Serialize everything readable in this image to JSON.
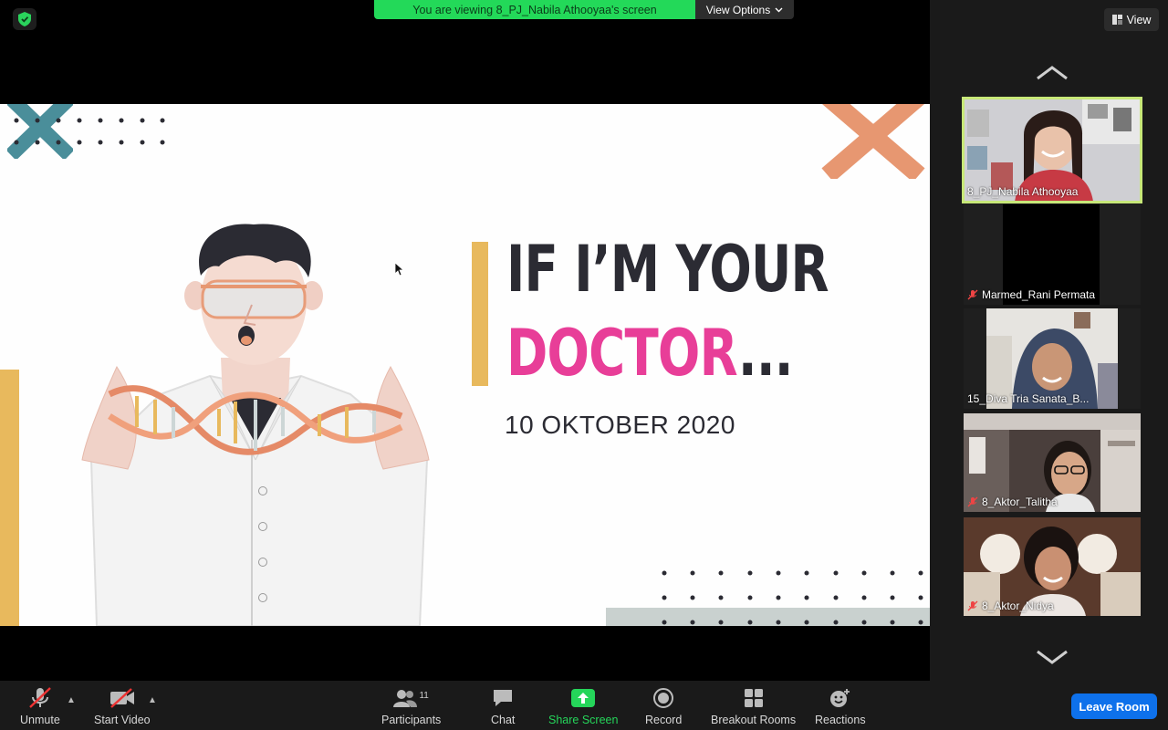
{
  "meeting": {
    "banner_text": "You are viewing 8_PJ_Nabila Athooyaa's screen",
    "view_options_label": "View Options",
    "view_label": "View"
  },
  "slide": {
    "title_line1": "IF I’M YOUR",
    "title_line2_highlight": "DOCTOR",
    "title_line2_rest": "...",
    "date": "10 OKTOBER 2020",
    "colors": {
      "pink": "#e83e98",
      "dark": "#2b2b33",
      "yellow": "#e8b95d",
      "orange": "#e79771",
      "teal": "#4a8e9a"
    }
  },
  "participants": [
    {
      "name": "8_PJ_Nabila Athooyaa",
      "muted": false,
      "active_speaker": true,
      "video": true
    },
    {
      "name": "Marmed_Rani Permata",
      "muted": true,
      "active_speaker": false,
      "video": false
    },
    {
      "name": "15_Diva Tria Sanata_B...",
      "muted": false,
      "active_speaker": false,
      "video": true
    },
    {
      "name": "8_Aktor_Talitha",
      "muted": true,
      "active_speaker": false,
      "video": true
    },
    {
      "name": "8_Aktor_Nidya",
      "muted": true,
      "active_speaker": false,
      "video": true
    }
  ],
  "toolbar": {
    "unmute_label": "Unmute",
    "start_video_label": "Start Video",
    "participants_label": "Participants",
    "participants_count": "11",
    "chat_label": "Chat",
    "share_screen_label": "Share Screen",
    "record_label": "Record",
    "breakout_rooms_label": "Breakout Rooms",
    "reactions_label": "Reactions",
    "leave_label": "Leave Room"
  }
}
